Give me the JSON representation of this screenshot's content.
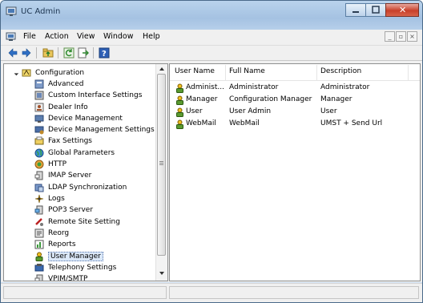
{
  "window": {
    "title": "UC Admin"
  },
  "menu": [
    "File",
    "Action",
    "View",
    "Window",
    "Help"
  ],
  "tree": {
    "root": "Configuration",
    "items": [
      "Advanced",
      "Custom Interface Settings",
      "Dealer Info",
      "Device Management",
      "Device Management Settings",
      "Fax Settings",
      "Global Parameters",
      "HTTP",
      "IMAP Server",
      "LDAP Synchronization",
      "Logs",
      "POP3 Server",
      "Remote Site Setting",
      "Reorg",
      "Reports",
      "User Manager",
      "Telephony Settings",
      "VPIM/SMTP"
    ],
    "selected": "User Manager"
  },
  "list": {
    "columns": [
      "User Name",
      "Full Name",
      "Description"
    ],
    "rows": [
      [
        "Administ...",
        "Administrator",
        "Administrator"
      ],
      [
        "Manager",
        "Configuration Manager",
        "Manager"
      ],
      [
        "User",
        "User Admin",
        "User"
      ],
      [
        "WebMail",
        "WebMail",
        "UMST + Send Url"
      ]
    ]
  },
  "colors": {
    "title_bg": "#b9d3ec",
    "selection": "#dbe8f8",
    "close_red": "#c8402a"
  }
}
